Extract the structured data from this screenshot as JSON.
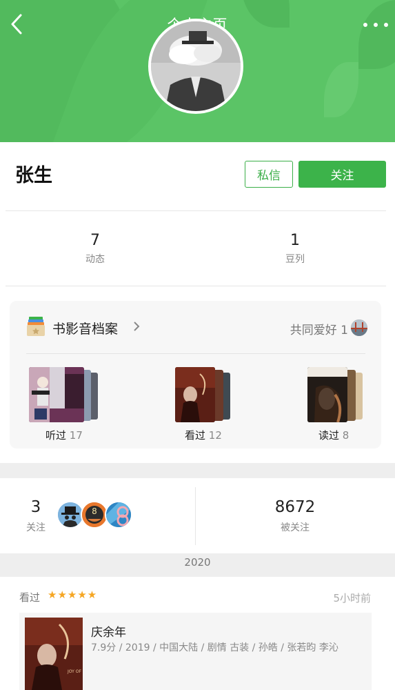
{
  "header": {
    "title": "个人主页",
    "back_icon": "chevron-left-icon",
    "more_icon": "more-dots-icon",
    "bg_color": "#5bc466"
  },
  "profile": {
    "name": "张生",
    "message_label": "私信",
    "follow_label": "关注",
    "accent_color": "#3cb34a"
  },
  "stats": [
    {
      "value": "7",
      "label": "动态"
    },
    {
      "value": "1",
      "label": "豆列"
    }
  ],
  "archive": {
    "title": "书影音档案",
    "common_label": "共同爱好 1",
    "groups": [
      {
        "label": "听过",
        "count": "17"
      },
      {
        "label": "看过",
        "count": "12"
      },
      {
        "label": "读过",
        "count": "8"
      }
    ]
  },
  "follows": {
    "following_count": "3",
    "following_label": "关注",
    "followers_count": "8672",
    "followers_label": "被关注"
  },
  "timeline": {
    "year": "2020",
    "activity": {
      "action": "看过",
      "stars": "★★★★★",
      "rating": 5,
      "time": "5小时前",
      "movie_title": "庆余年",
      "movie_meta": "7.9分 / 2019 / 中国大陆 / 剧情 古装 / 孙皓 / 张若昀 李沁"
    }
  }
}
